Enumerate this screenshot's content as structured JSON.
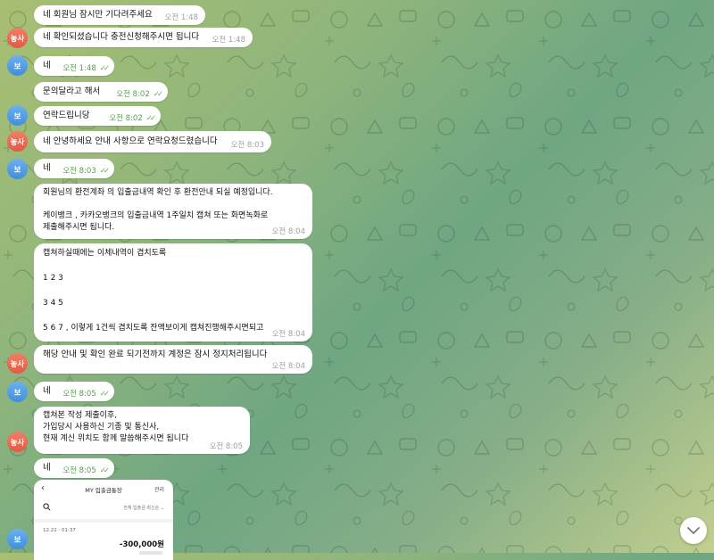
{
  "avatars": {
    "counselor": "놓사",
    "user": "보"
  },
  "messages": [
    {
      "text": "네 회원님 잠시만 기다려주세요",
      "time": "오전 1:48"
    },
    {
      "text": "네 확인되셨습니다 충전신청해주시면 됩니다",
      "time": "오전 1:48"
    },
    {
      "text": "네",
      "time": "오전 1:48"
    },
    {
      "text": "문의달라고 해서",
      "time": "오전 8:02"
    },
    {
      "text": "연락드립니당",
      "time": "오전 8:02"
    },
    {
      "text": "네 안녕하세요 안내 사항으로 연락요청드렸습니다",
      "time": "오전 8:03"
    },
    {
      "text": "네",
      "time": "오전 8:03"
    },
    {
      "text": "회원님의 환전계좌 의 입출금내역 확인 후 환전안내 되실 예정입니다.\n\n케이뱅크 , 카카오뱅크의 입출금내역 1주일치 캡쳐 또는 화면녹화로\n제출해주시면 됩니다.",
      "time": "오전 8:04"
    },
    {
      "text": "캡쳐하실때에는 이체내역이 겹치도록\n\n1 2 3\n\n3 4 5\n\n5 6 7 , 이렇게 1건씩 겹치도록 잔액보이게 캡쳐진행해주시면되고",
      "time": "오전 8:04"
    },
    {
      "text": "해당 안내 및 확인 완료 되기전까지 계정은 잠시 정지처리됩니다",
      "time": "오전 8:04"
    },
    {
      "text": "네",
      "time": "오전 8:05"
    },
    {
      "text": "캡쳐본 작성 제출이후,\n가입당시 사용하신 기종 및 통신사,\n현재 계신 위치도 함께 말씀해주시면 됩니다",
      "time": "오전 8:05"
    },
    {
      "text": "네",
      "time": "오전 8:05"
    }
  ],
  "screenshot": {
    "title": "MY 입출금통장",
    "manage": "관리",
    "filter": "전체·입출금·최신순 ⌄",
    "date": "12.22 · 01:37",
    "amount": "-300,000원"
  }
}
